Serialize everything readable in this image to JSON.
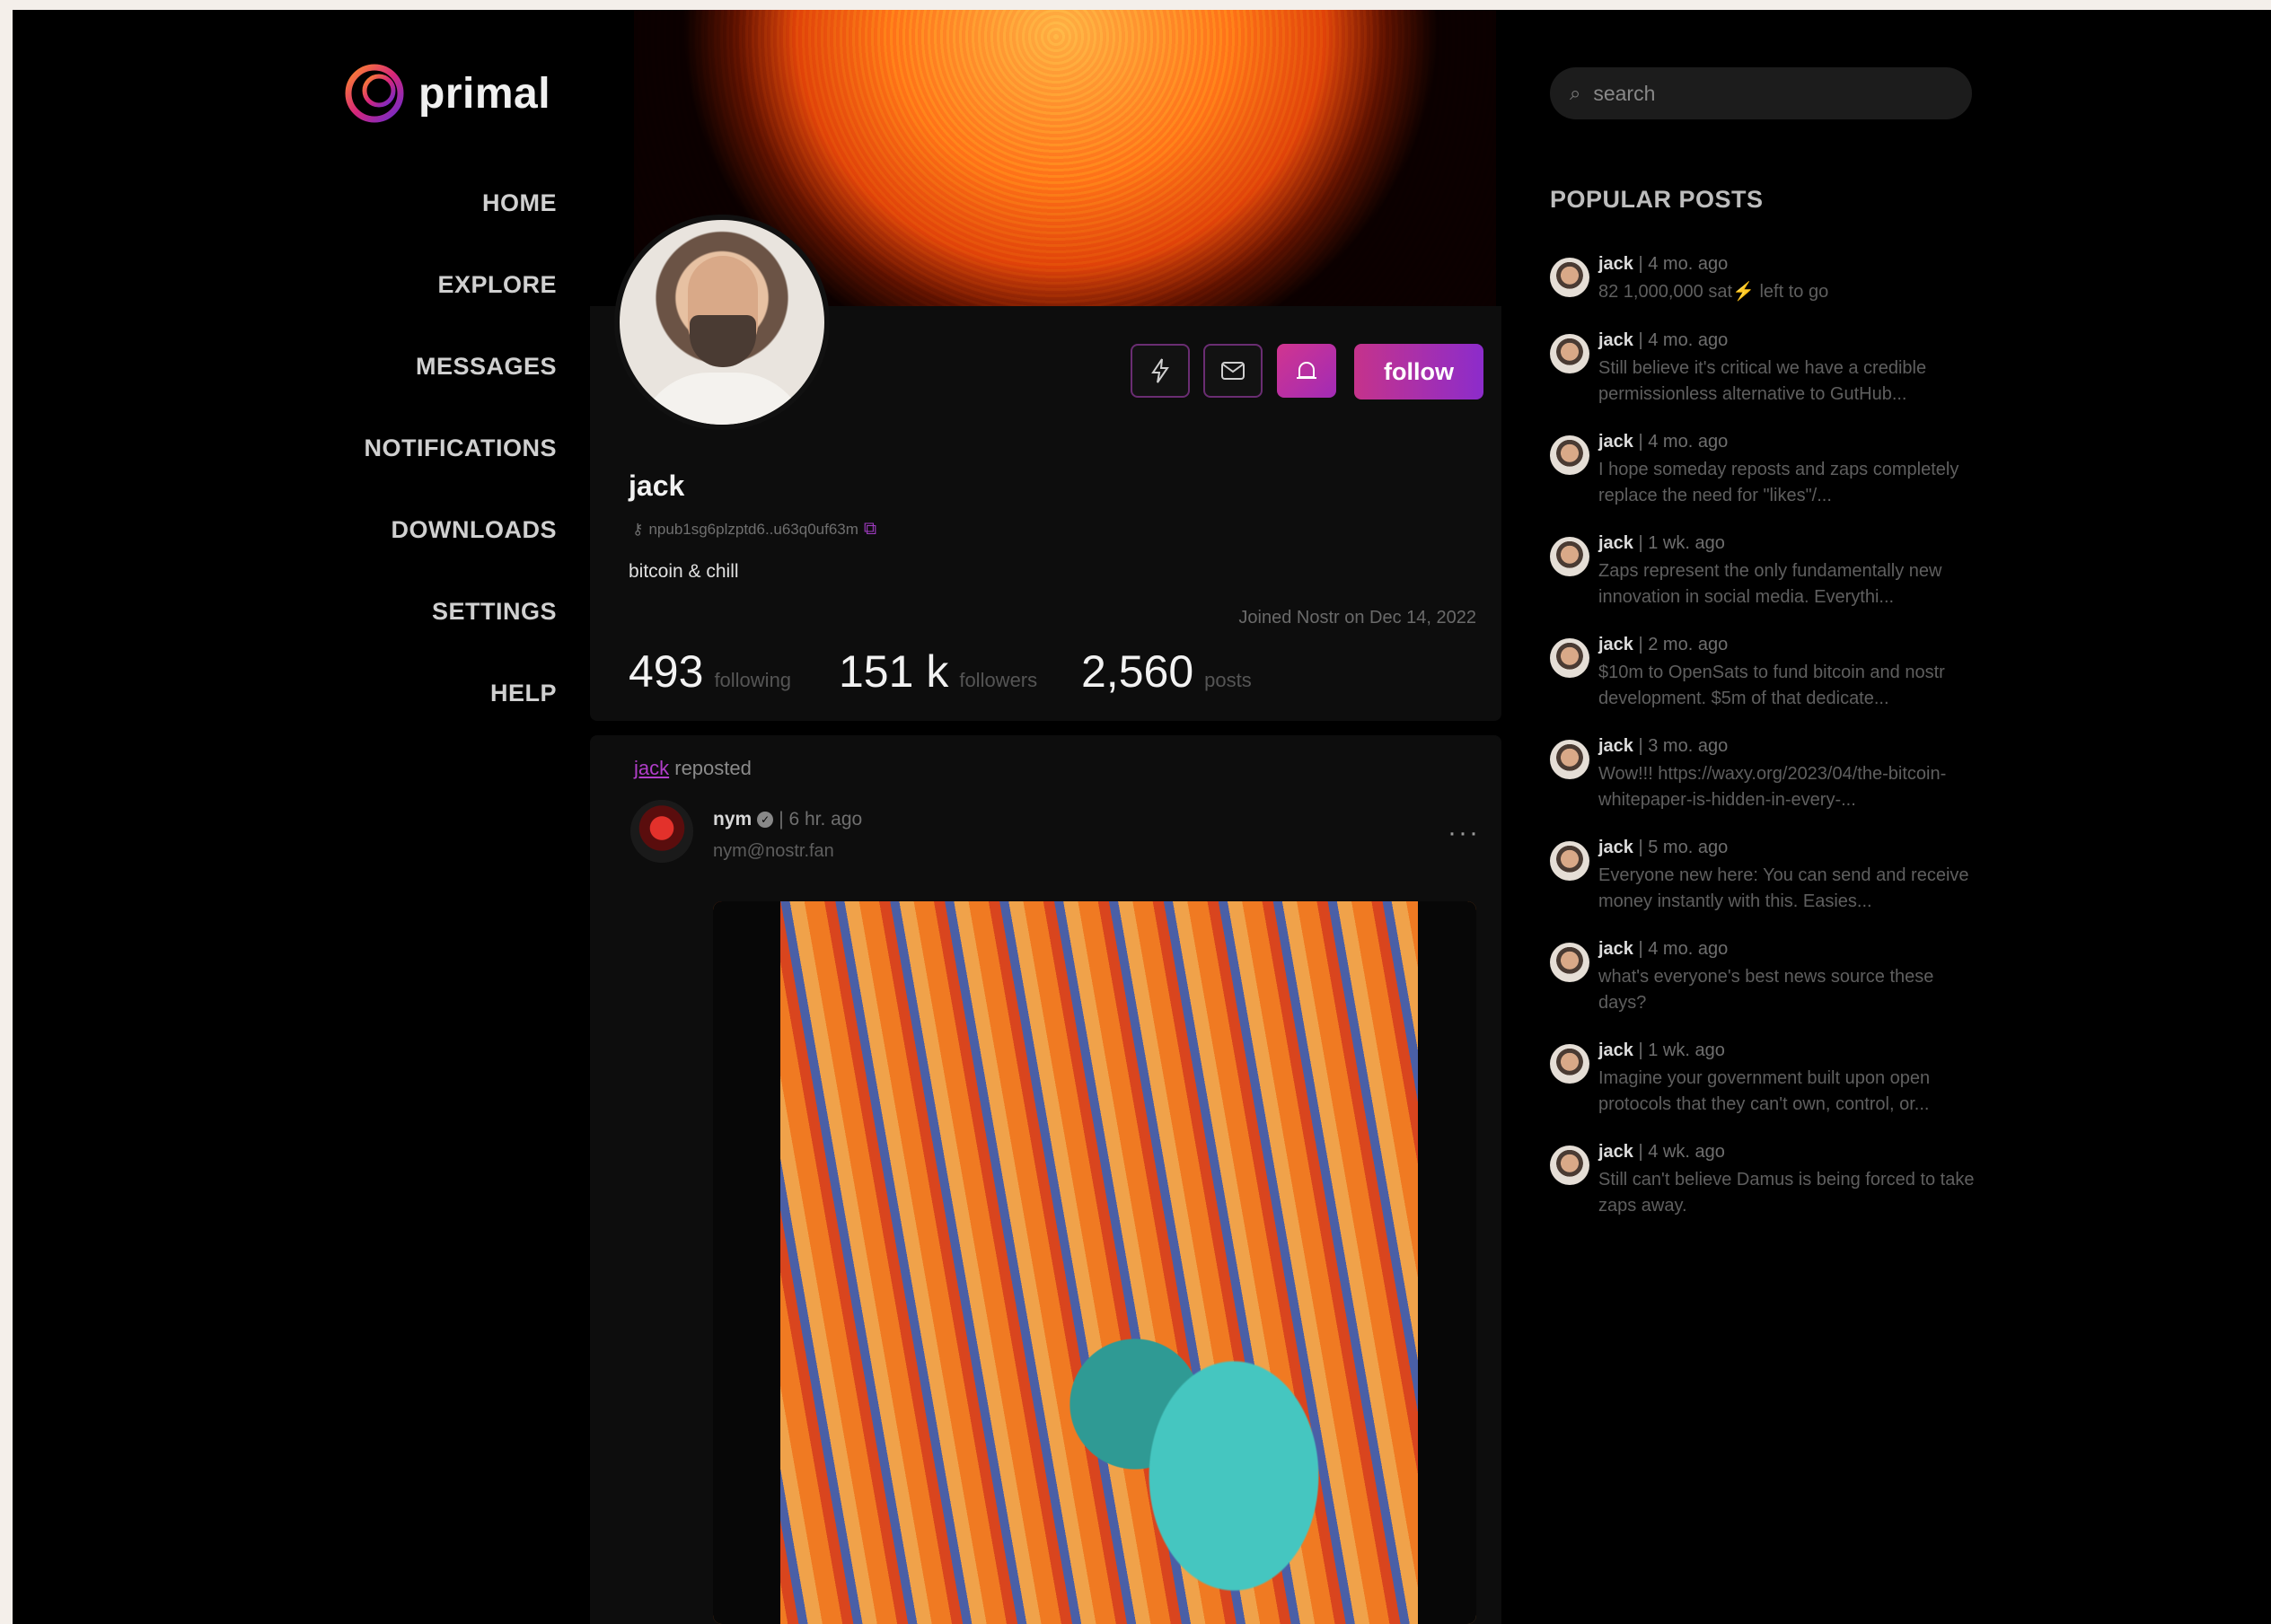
{
  "app": {
    "name": "primal"
  },
  "nav": {
    "items": [
      {
        "label": "HOME"
      },
      {
        "label": "EXPLORE"
      },
      {
        "label": "MESSAGES"
      },
      {
        "label": "NOTIFICATIONS"
      },
      {
        "label": "DOWNLOADS"
      },
      {
        "label": "SETTINGS"
      },
      {
        "label": "HELP"
      }
    ]
  },
  "profile": {
    "name": "jack",
    "npub": "npub1sg6plzptd6..u63q0uf63m",
    "bio": "bitcoin & chill",
    "joined": "Joined Nostr on Dec 14, 2022",
    "follow_label": "follow",
    "stats": {
      "following": {
        "value": "493",
        "label": "following"
      },
      "followers": {
        "value": "151 k",
        "label": "followers"
      },
      "posts": {
        "value": "2,560",
        "label": "posts"
      }
    }
  },
  "feed": {
    "repost_user": "jack",
    "repost_text": "reposted",
    "post": {
      "author": "nym",
      "time": "| 6 hr. ago",
      "handle": "nym@nostr.fan",
      "menu": "···"
    }
  },
  "search": {
    "placeholder": "search"
  },
  "popular": {
    "title": "POPULAR POSTS",
    "items": [
      {
        "user": "jack",
        "time": "| 4 mo. ago",
        "text": "82 1,000,000 sat⚡ left to go"
      },
      {
        "user": "jack",
        "time": "| 4 mo. ago",
        "text": "Still believe it's critical we have a credible permissionless alternative to GutHub..."
      },
      {
        "user": "jack",
        "time": "| 4 mo. ago",
        "text": "I hope someday reposts and zaps completely replace the need for \"likes\"/..."
      },
      {
        "user": "jack",
        "time": "| 1 wk. ago",
        "text": "Zaps represent the only fundamentally new innovation in social media. Everythi..."
      },
      {
        "user": "jack",
        "time": "| 2 mo. ago",
        "text": "$10m to OpenSats to fund bitcoin and nostr development. $5m of that dedicate..."
      },
      {
        "user": "jack",
        "time": "| 3 mo. ago",
        "text": "Wow!!! https://waxy.org/2023/04/the-bitcoin-whitepaper-is-hidden-in-every-..."
      },
      {
        "user": "jack",
        "time": "| 5 mo. ago",
        "text": "Everyone new here: You can send and receive money instantly with this. Easies..."
      },
      {
        "user": "jack",
        "time": "| 4 mo. ago",
        "text": "what's everyone's best news source these days?"
      },
      {
        "user": "jack",
        "time": "| 1 wk. ago",
        "text": "Imagine your government built upon open protocols that they can't own, control, or..."
      },
      {
        "user": "jack",
        "time": "| 4 wk. ago",
        "text": "Still can't believe Damus is being forced to take zaps away."
      }
    ]
  },
  "icons": {
    "zap": "lightning-icon",
    "message": "envelope-icon",
    "mute": "mute-icon",
    "search": "search-icon",
    "key": "key-icon",
    "copy": "copy-icon",
    "verified": "verified-icon"
  },
  "colors": {
    "accent": "#b13ec9",
    "follow_start": "#c5338b",
    "follow_end": "#8c2ccb"
  }
}
